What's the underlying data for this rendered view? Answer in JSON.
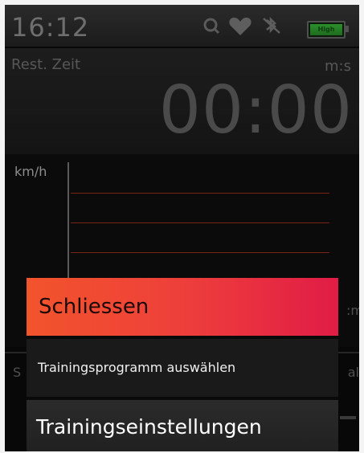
{
  "status_bar": {
    "time": "16:12",
    "icons": [
      "search-icon",
      "heart-icon",
      "bluetooth-off-icon",
      "battery-icon"
    ],
    "battery_text": "High"
  },
  "time_panel": {
    "label": "Rest. Zeit",
    "unit": "m:s",
    "value": "00:00"
  },
  "graph": {
    "y_label": "km/h",
    "x_unit": ":m",
    "partial_left": "S",
    "partial_right": "al"
  },
  "menu": {
    "items": [
      {
        "label": "Schliessen",
        "selected": true
      },
      {
        "label": "Trainingsprogramm auswählen",
        "selected": false
      },
      {
        "label": "Trainingseinstellungen",
        "selected": false
      }
    ]
  },
  "colors": {
    "accent_gradient_start": "#f2542c",
    "accent_gradient_end": "#e11c46",
    "graph_line": "#7a2416",
    "background": "#080808"
  }
}
